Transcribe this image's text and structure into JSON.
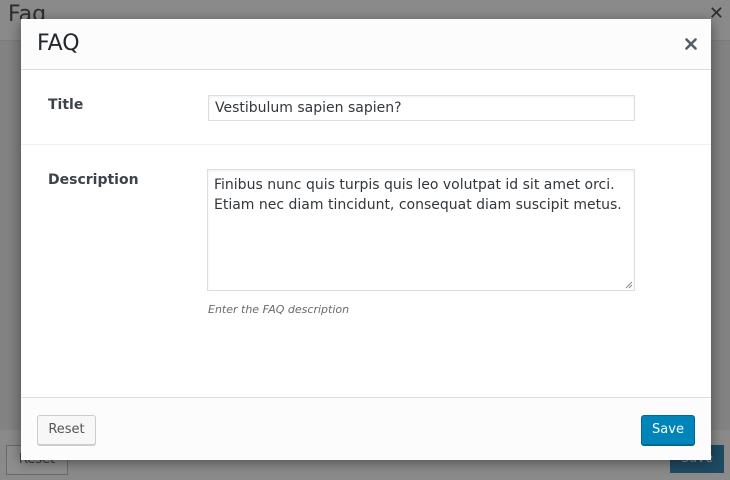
{
  "background": {
    "title": "Faq",
    "close_symbol": "✕",
    "reset_label": "Reset",
    "save_label": "Save"
  },
  "modal": {
    "title": "FAQ",
    "close_icon": "close-icon",
    "fields": {
      "title": {
        "label": "Title",
        "value": "Vestibulum sapien sapien?"
      },
      "description": {
        "label": "Description",
        "value": "Finibus nunc quis turpis quis leo volutpat id sit amet orci. Etiam nec diam tincidunt, consequat diam suscipit metus.",
        "help": "Enter the FAQ description"
      }
    },
    "footer": {
      "reset_label": "Reset",
      "save_label": "Save"
    }
  },
  "colors": {
    "primary": "#0085ba",
    "overlay": "#7a7a7a"
  }
}
